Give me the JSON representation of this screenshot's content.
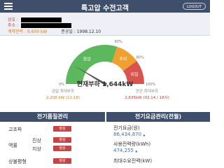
{
  "header": {
    "title": "특고압 수전고객",
    "logout_label": "LOGOUT",
    "menu_icon": "hamburger-icon"
  },
  "info": {
    "customer_label": "상호 :",
    "address_label": "주소 :",
    "contract_label": "계약전력 : 9,600 kW",
    "completion_label": "준공일 : 1998.12.10"
  },
  "gauge": {
    "zones": [
      {
        "label": "정상",
        "from": 0,
        "to": 60,
        "color": "#5cb85c"
      },
      {
        "label": "주의",
        "from": 60,
        "to": 80,
        "color": "#f0a030"
      },
      {
        "label": "위험",
        "from": 80,
        "to": 100,
        "color": "#d9534f"
      }
    ],
    "ticks": [
      "0%",
      "60%",
      "80%",
      "100%"
    ],
    "current_fraction": 0.171,
    "current_load_text": "현재부하 1,644kW"
  },
  "max_load": {
    "today_label": "금일 최대부하",
    "today_value": "2,208 kW (11:18)",
    "year_label": "연간 최대부하",
    "year_value": "2,635kW (02.14 / 18시)"
  },
  "power_quality": {
    "title": "전기품질관리",
    "rows": [
      {
        "label": "고조파",
        "status": "정상"
      },
      {
        "label": "역률",
        "sub": "진상",
        "status": "정상"
      },
      {
        "sub": "지상",
        "status": "정상"
      },
      {
        "label": "상불평형",
        "status": "정상"
      }
    ]
  },
  "billing": {
    "title": "전기요금관리(전월)",
    "fee_label": "전기요금(원)",
    "fee_value": "86,434,870",
    "usage_label": "사용전력량(kWh)",
    "usage_value": "474,255",
    "max_demand_label": "최대수요전력(kW)"
  },
  "colors": {
    "header_bg": "#3f4f6b",
    "accent_red": "#c03a2b",
    "status_btn": "#c44545",
    "value_blue": "#3f6fb3"
  }
}
